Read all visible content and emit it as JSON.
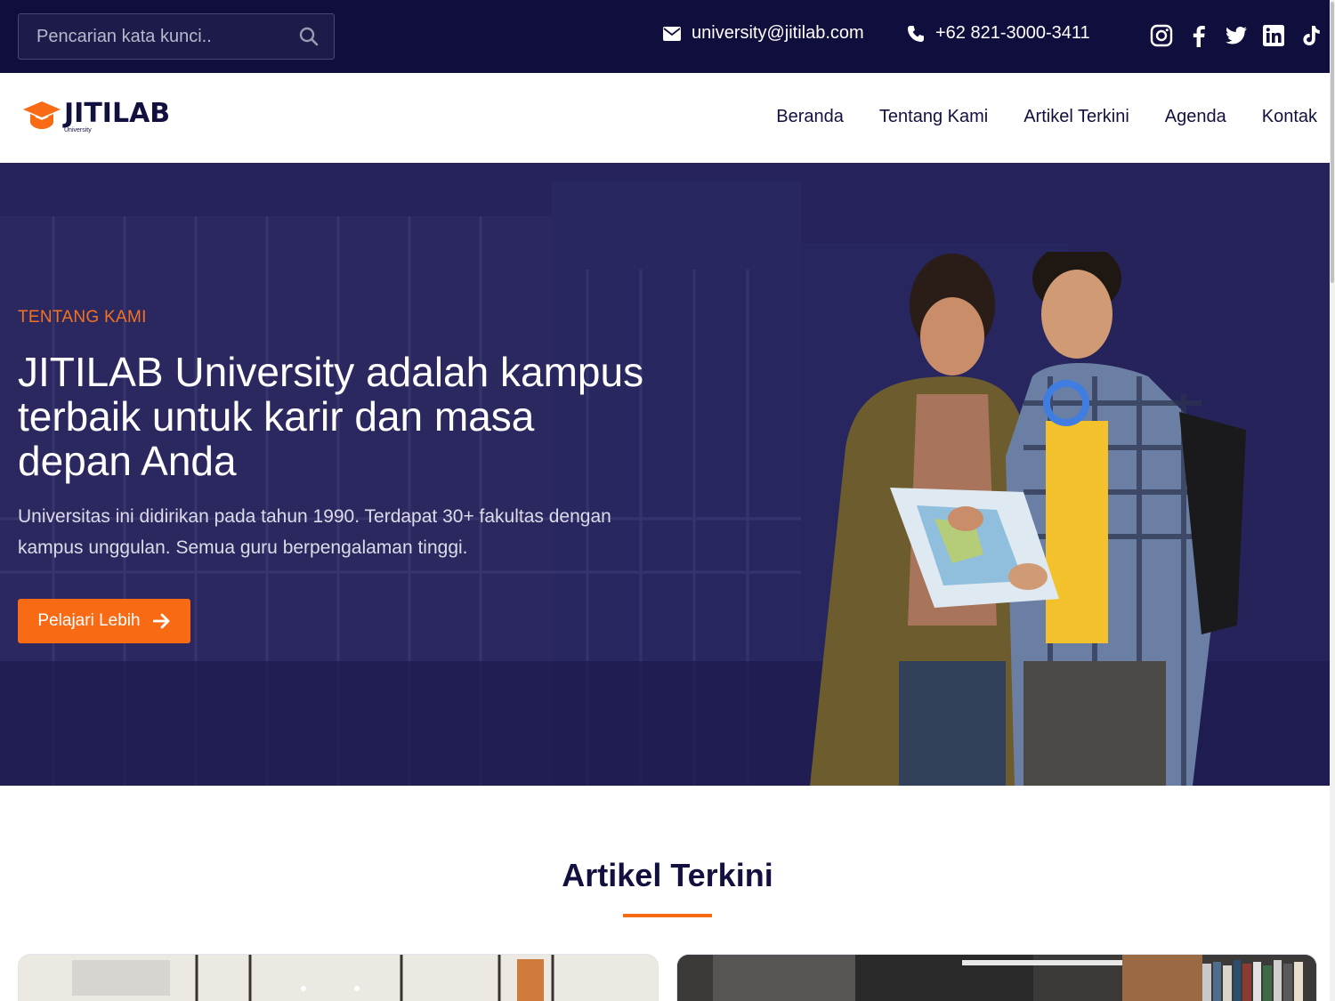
{
  "topbar": {
    "search_placeholder": "Pencarian kata kunci..",
    "email": "university@jitilab.com",
    "phone": "+62 821-3000-3411",
    "socials": [
      "instagram-icon",
      "facebook-icon",
      "twitter-icon",
      "linkedin-icon",
      "tiktok-icon"
    ]
  },
  "brand": {
    "name": "JITILAB",
    "tagline": "University",
    "accent": "#f96a14",
    "navy": "#100e3d"
  },
  "nav": {
    "items": [
      {
        "label": "Beranda"
      },
      {
        "label": "Tentang Kami"
      },
      {
        "label": "Artikel Terkini"
      },
      {
        "label": "Agenda"
      },
      {
        "label": "Kontak"
      }
    ]
  },
  "hero": {
    "eyebrow": "TENTANG KAMI",
    "title": "JITILAB University adalah kampus terbaik untuk karir dan masa depan Anda",
    "lead": "Universitas ini didirikan pada tahun 1990. Terdapat 30+ fakultas dengan kampus unggulan. Semua guru berpengalaman tinggi.",
    "cta_label": "Pelajari Lebih"
  },
  "articles": {
    "title": "Artikel Terkini"
  }
}
